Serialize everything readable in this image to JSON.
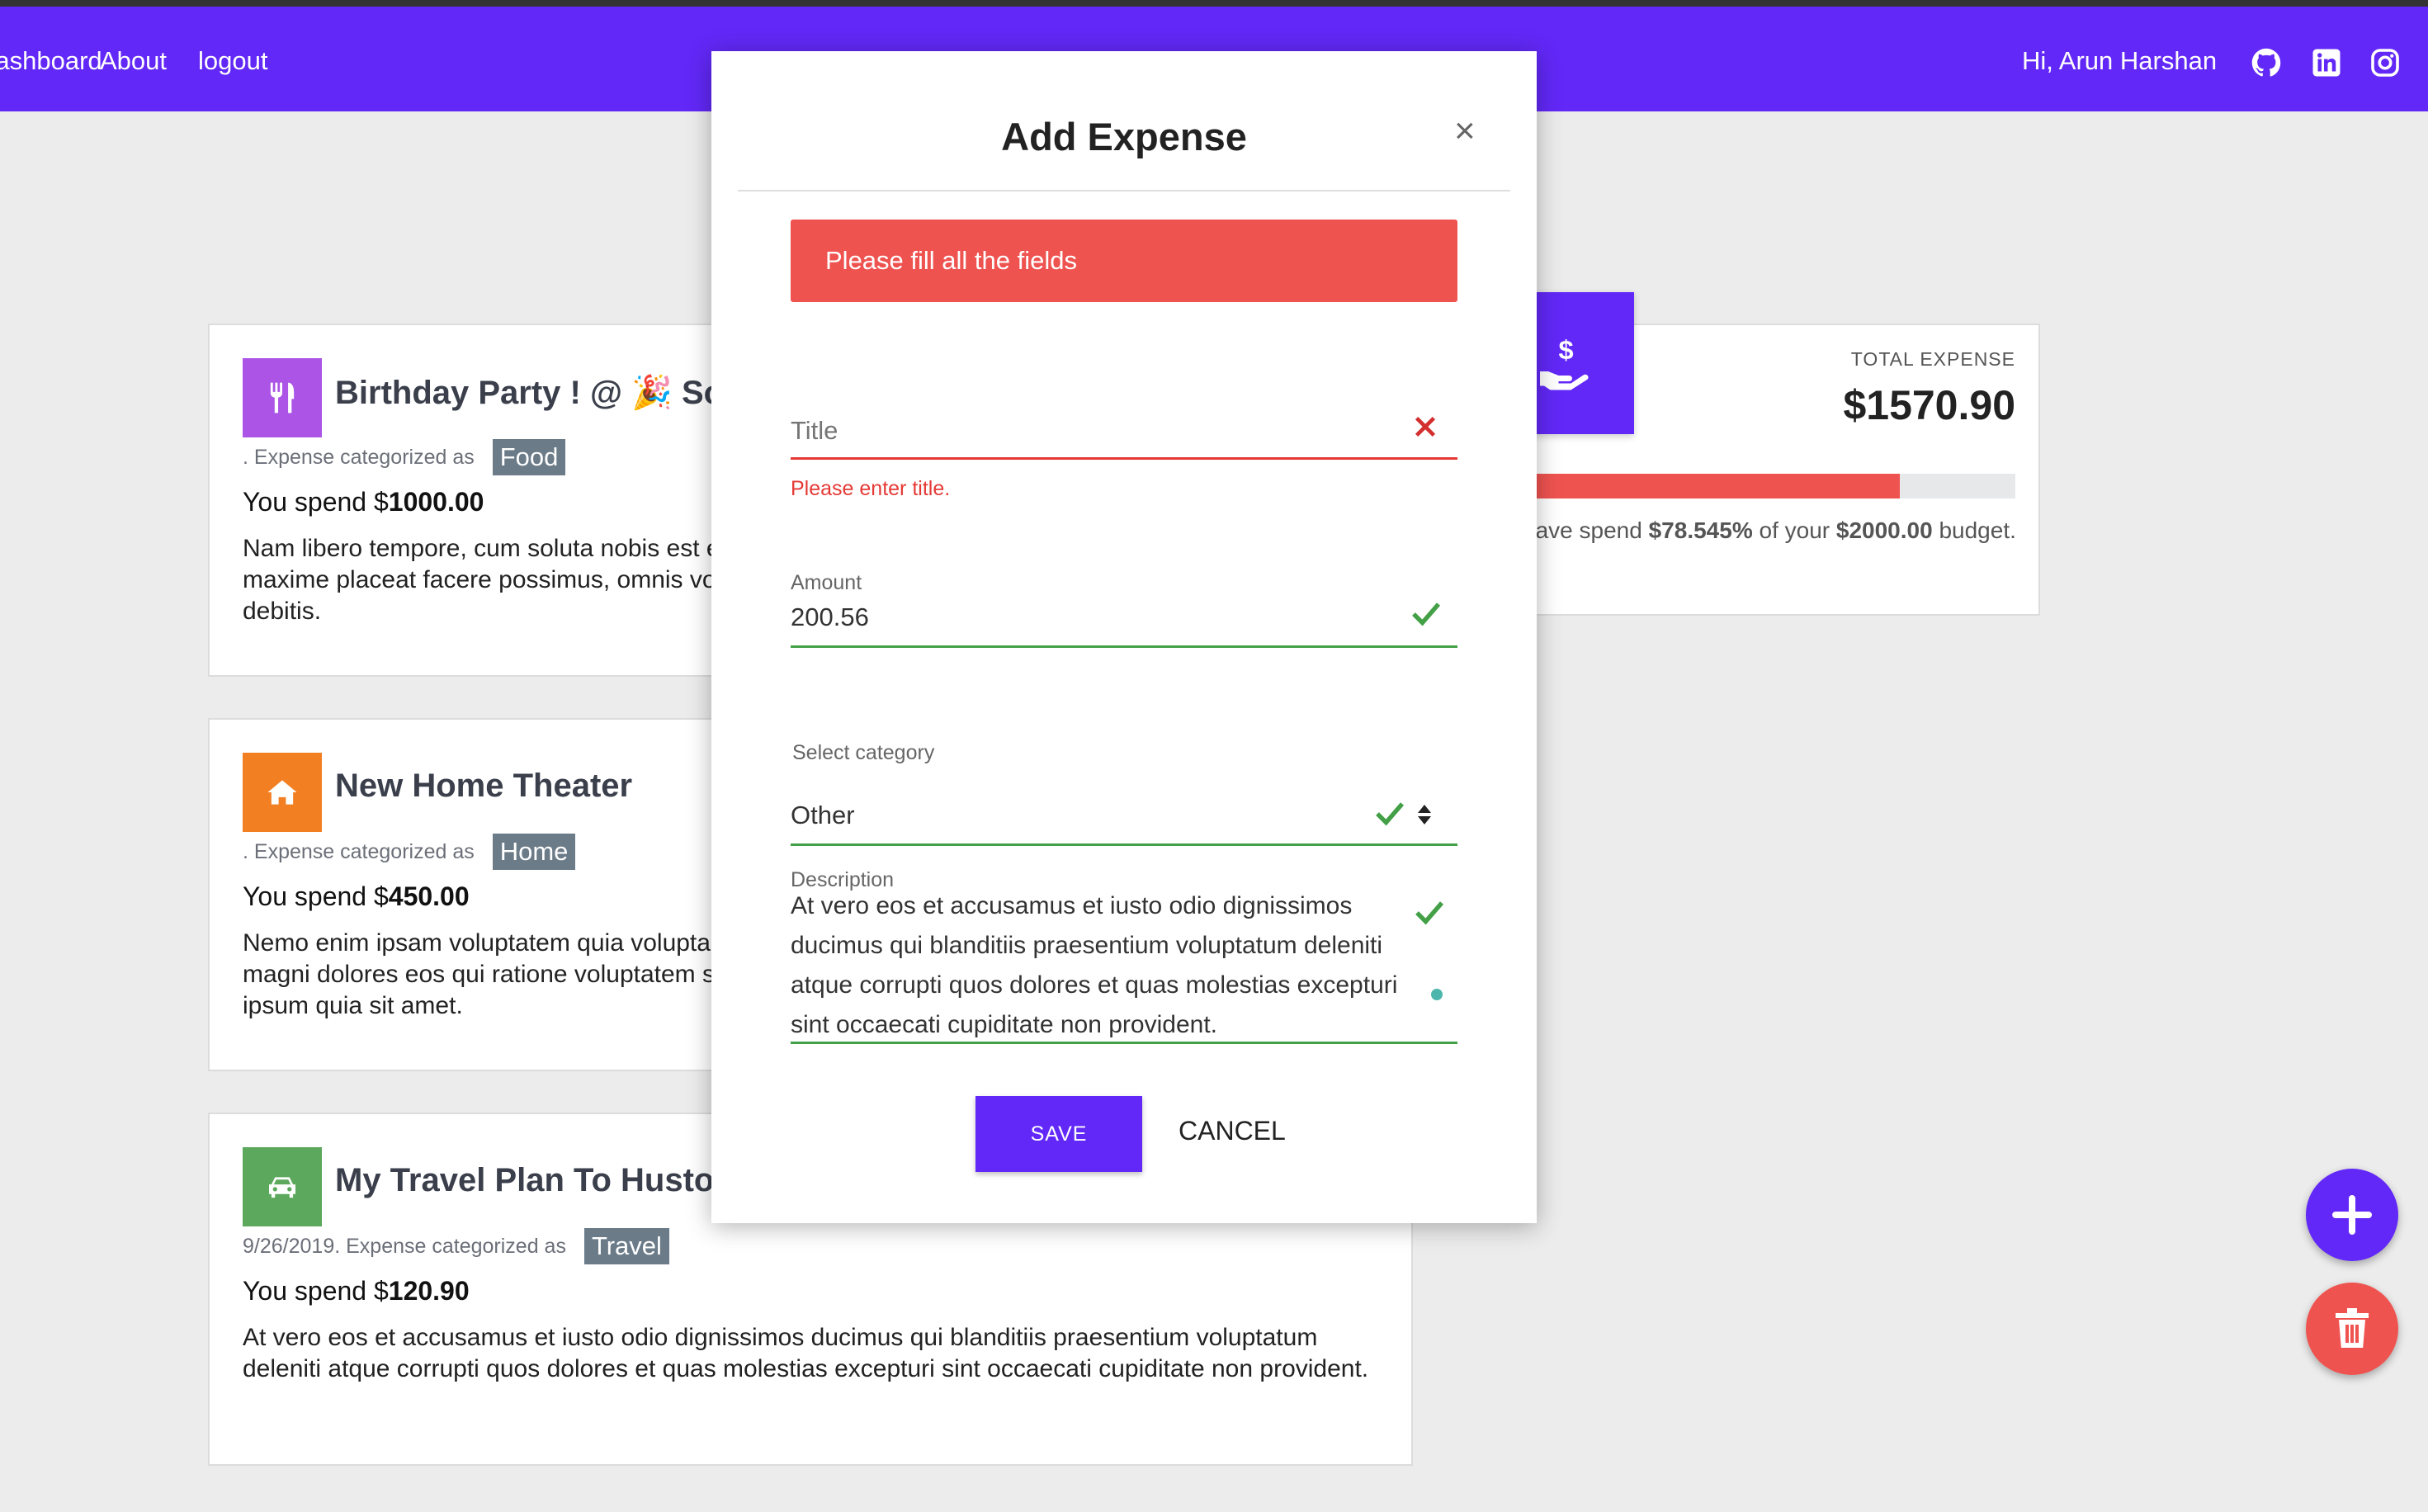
{
  "nav": {
    "links": [
      "Dashboard",
      "About",
      "logout"
    ],
    "greeting": "Hi, Arun Harshan",
    "icons": [
      "github-icon",
      "linkedin-icon",
      "instagram-icon"
    ],
    "color": "#6228f7"
  },
  "expenses": [
    {
      "title": "Birthday Party ! @ 🎉 Sonic",
      "date": "",
      "category_prefix": ". Expense categorized as",
      "category": "Food",
      "category_color": "#ab54e6",
      "icon": "utensils-icon",
      "spend_prefix": "You spend $",
      "amount": "1000.00",
      "description": "Nam libero tempore, cum soluta nobis est eligendi optio cumque nihil impedit quo minus id quod maxime placeat facere possimus, omnis voluptas assumenda est, omnis dolor repellendus et aut officiis debitis."
    },
    {
      "title": "New Home Theater",
      "date": "",
      "category_prefix": ". Expense categorized as",
      "category": "Home",
      "category_color": "#f27f22",
      "icon": "home-icon",
      "spend_prefix": "You spend $",
      "amount": "450.00",
      "description": "Nemo enim ipsam voluptatem quia voluptas sit aspernatur aut odit aut fugit, sed quia consequuntur magni dolores eos qui ratione voluptatem sequi nesciunt. Neque porro quisquam est, qui dolorem ipsum quia sit amet."
    },
    {
      "title": "My Travel Plan To Huston",
      "date": "9/26/2019",
      "category_prefix": ". Expense categorized as",
      "category": "Travel",
      "category_color": "#5ca85c",
      "icon": "car-icon",
      "spend_prefix": "You spend $",
      "amount": "120.90",
      "description": "At vero eos et accusamus et iusto odio dignissimos ducimus qui blanditiis praesentium voluptatum deleniti atque corrupti quos dolores et quas molestias excepturi sint occaecati cupiditate non provident."
    }
  ],
  "summary": {
    "label": "TOTAL EXPENSE",
    "total": "$1570.90",
    "progress_percent": 78.545,
    "text_prefix": "You have spend",
    "percent_text": "$78.545%",
    "text_middle": "of your",
    "budget": "$2000.00",
    "text_suffix": "budget.",
    "icon": "money-hand-icon"
  },
  "modal": {
    "title": "Add Expense",
    "close": "×",
    "alert": "Please fill all the fields",
    "title_field": {
      "placeholder": "Title",
      "error": "Please enter title."
    },
    "amount_field": {
      "label": "Amount",
      "value": "200.56"
    },
    "category_field": {
      "label": "Select category",
      "value": "Other"
    },
    "description_field": {
      "label": "Description",
      "value": "At vero eos et accusamus et iusto odio dignissimos ducimus qui blanditiis praesentium voluptatum deleniti atque corrupti quos dolores et quas molestias excepturi sint occaecati cupiditate non provident."
    },
    "save": "SAVE",
    "cancel": "CANCEL"
  },
  "colors": {
    "accent": "#6228f7",
    "error": "#ef5350",
    "success": "#43a047"
  }
}
